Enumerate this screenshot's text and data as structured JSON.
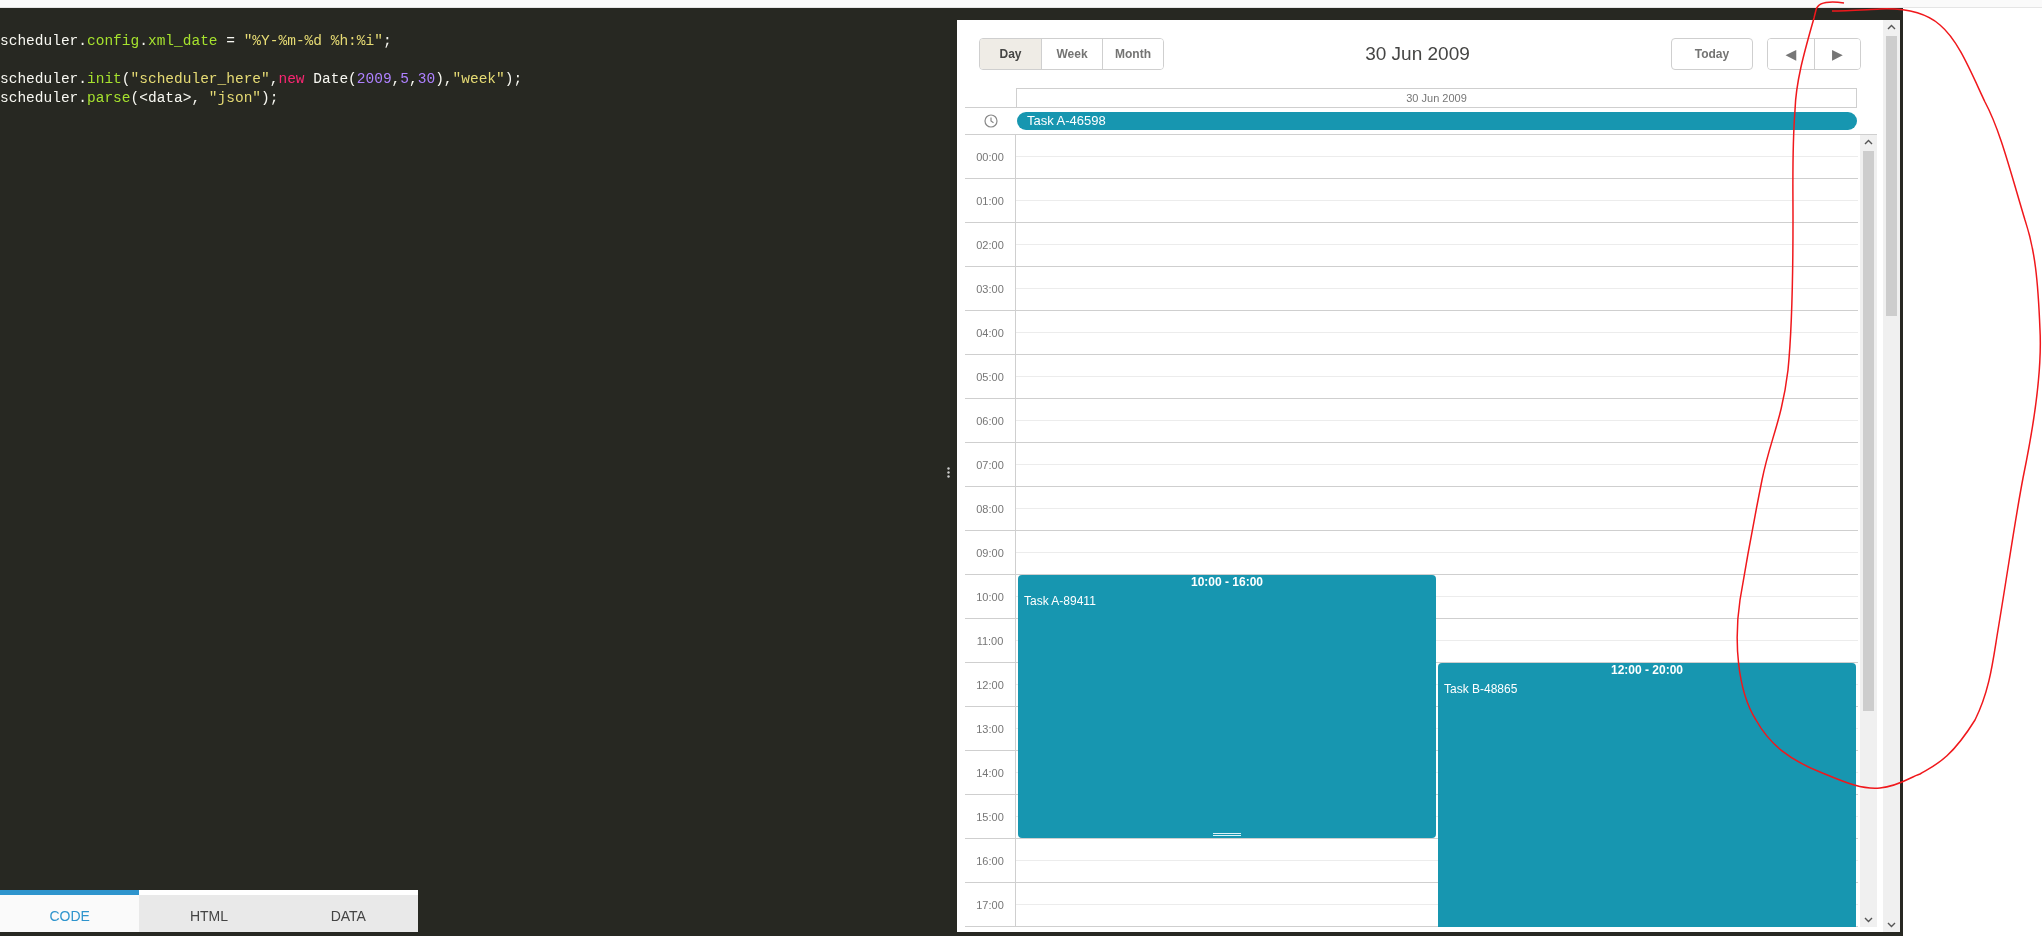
{
  "editor": {
    "lines": [
      {
        "kind": "code",
        "tokens": [
          {
            "kind": "plain",
            "text": "scheduler."
          },
          {
            "kind": "prop",
            "text": "config"
          },
          {
            "kind": "plain",
            "text": "."
          },
          {
            "kind": "prop",
            "text": "xml_date"
          },
          {
            "kind": "plain",
            "text": " = "
          },
          {
            "kind": "string",
            "text": "\"%Y-%m-%d %h:%i\""
          },
          {
            "kind": "plain",
            "text": ";"
          }
        ]
      },
      {
        "kind": "blank"
      },
      {
        "kind": "code",
        "tokens": [
          {
            "kind": "plain",
            "text": "scheduler."
          },
          {
            "kind": "prop",
            "text": "init"
          },
          {
            "kind": "plain",
            "text": "("
          },
          {
            "kind": "string",
            "text": "\"scheduler_here\""
          },
          {
            "kind": "plain",
            "text": ","
          },
          {
            "kind": "keyword",
            "text": "new"
          },
          {
            "kind": "plain",
            "text": " Date("
          },
          {
            "kind": "number",
            "text": "2009"
          },
          {
            "kind": "plain",
            "text": ","
          },
          {
            "kind": "number",
            "text": "5"
          },
          {
            "kind": "plain",
            "text": ","
          },
          {
            "kind": "number",
            "text": "30"
          },
          {
            "kind": "plain",
            "text": "),"
          },
          {
            "kind": "string",
            "text": "\"week\""
          },
          {
            "kind": "plain",
            "text": ");"
          }
        ]
      },
      {
        "kind": "code",
        "tokens": [
          {
            "kind": "plain",
            "text": "scheduler."
          },
          {
            "kind": "prop",
            "text": "parse"
          },
          {
            "kind": "plain",
            "text": "(<data>, "
          },
          {
            "kind": "string",
            "text": "\"json\""
          },
          {
            "kind": "plain",
            "text": ");"
          }
        ]
      }
    ]
  },
  "tabs": [
    {
      "label": "CODE",
      "selected": true
    },
    {
      "label": "HTML",
      "selected": false
    },
    {
      "label": "DATA",
      "selected": false
    }
  ],
  "scheduler": {
    "views": [
      {
        "label": "Day",
        "selected": true
      },
      {
        "label": "Week",
        "selected": false
      },
      {
        "label": "Month",
        "selected": false
      }
    ],
    "title": "30 Jun 2009",
    "today": "Today",
    "prev": "◀",
    "next": "▶",
    "day_header": "30 Jun 2009",
    "all_day_events": [
      {
        "text": "Task A-46598"
      }
    ],
    "hours": [
      "00:00",
      "01:00",
      "02:00",
      "03:00",
      "04:00",
      "05:00",
      "06:00",
      "07:00",
      "08:00",
      "09:00",
      "10:00",
      "11:00",
      "12:00",
      "13:00",
      "14:00",
      "15:00",
      "16:00",
      "17:00"
    ],
    "events": [
      {
        "time": "10:00 - 16:00",
        "text": "Task A-89411"
      },
      {
        "time": "12:00 - 20:00",
        "text": "Task B-48865"
      }
    ]
  }
}
